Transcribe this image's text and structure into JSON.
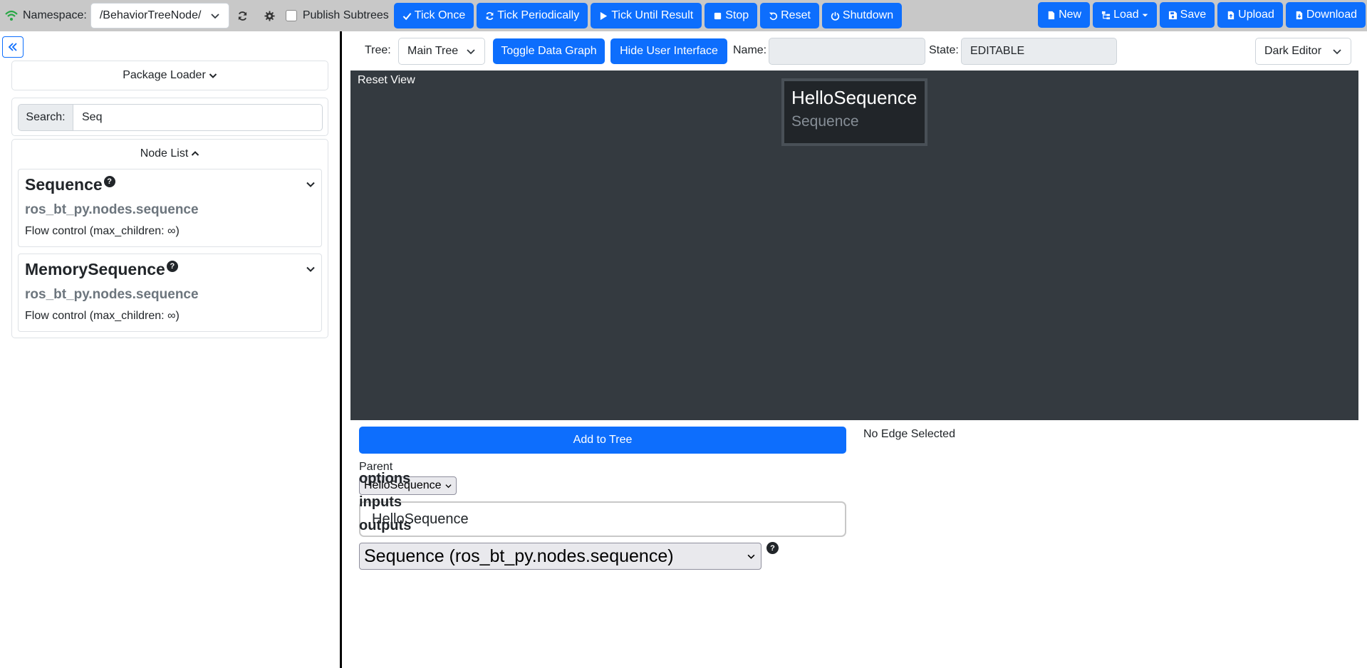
{
  "topbar": {
    "namespace_label": "Namespace:",
    "namespace_value": "/BehaviorTreeNode/",
    "publish_subtrees_label": "Publish Subtrees",
    "buttons": {
      "tick_once": "Tick Once",
      "tick_periodically": "Tick Periodically",
      "tick_until_result": "Tick Until Result",
      "stop": "Stop",
      "reset": "Reset",
      "shutdown": "Shutdown",
      "new": "New",
      "load": "Load",
      "save": "Save",
      "upload": "Upload",
      "download": "Download"
    },
    "icons": {
      "connection": "wifi-icon",
      "refresh": "refresh-icon",
      "settings": "gear-icon"
    }
  },
  "sidebar": {
    "package_loader": "Package Loader",
    "search_label": "Search:",
    "search_value": "Seq",
    "node_list_label": "Node List",
    "nodes": [
      {
        "name": "Sequence",
        "module": "ros_bt_py.nodes.sequence",
        "description": "Flow control (max_children: ∞)"
      },
      {
        "name": "MemorySequence",
        "module": "ros_bt_py.nodes.sequence",
        "description": "Flow control (max_children: ∞)"
      }
    ]
  },
  "editor": {
    "tree_label": "Tree:",
    "tree_value": "Main Tree",
    "toggle_data_graph": "Toggle Data Graph",
    "hide_user_interface": "Hide User Interface",
    "name_label": "Name:",
    "name_value": "",
    "state_label": "State:",
    "state_value": "EDITABLE",
    "theme_value": "Dark Editor"
  },
  "canvas": {
    "reset_view": "Reset View",
    "node": {
      "title": "HelloSequence",
      "type": "Sequence"
    }
  },
  "node_panel": {
    "add_to_tree": "Add to Tree",
    "no_edge": "No Edge Selected",
    "parent_label": "Parent",
    "parent_value": "HelloSequence",
    "node_name_value": "HelloSequence",
    "node_class_value": "Sequence (ros_bt_py.nodes.sequence)",
    "sections": {
      "options": "options",
      "inputs": "inputs",
      "outputs": "outputs"
    }
  },
  "colors": {
    "toolbar_bg": "#c8c8c8",
    "primary": "#0d6efd",
    "canvas_bg": "#343a40",
    "node_bg": "#212529",
    "connection_ok": "#28a745"
  }
}
